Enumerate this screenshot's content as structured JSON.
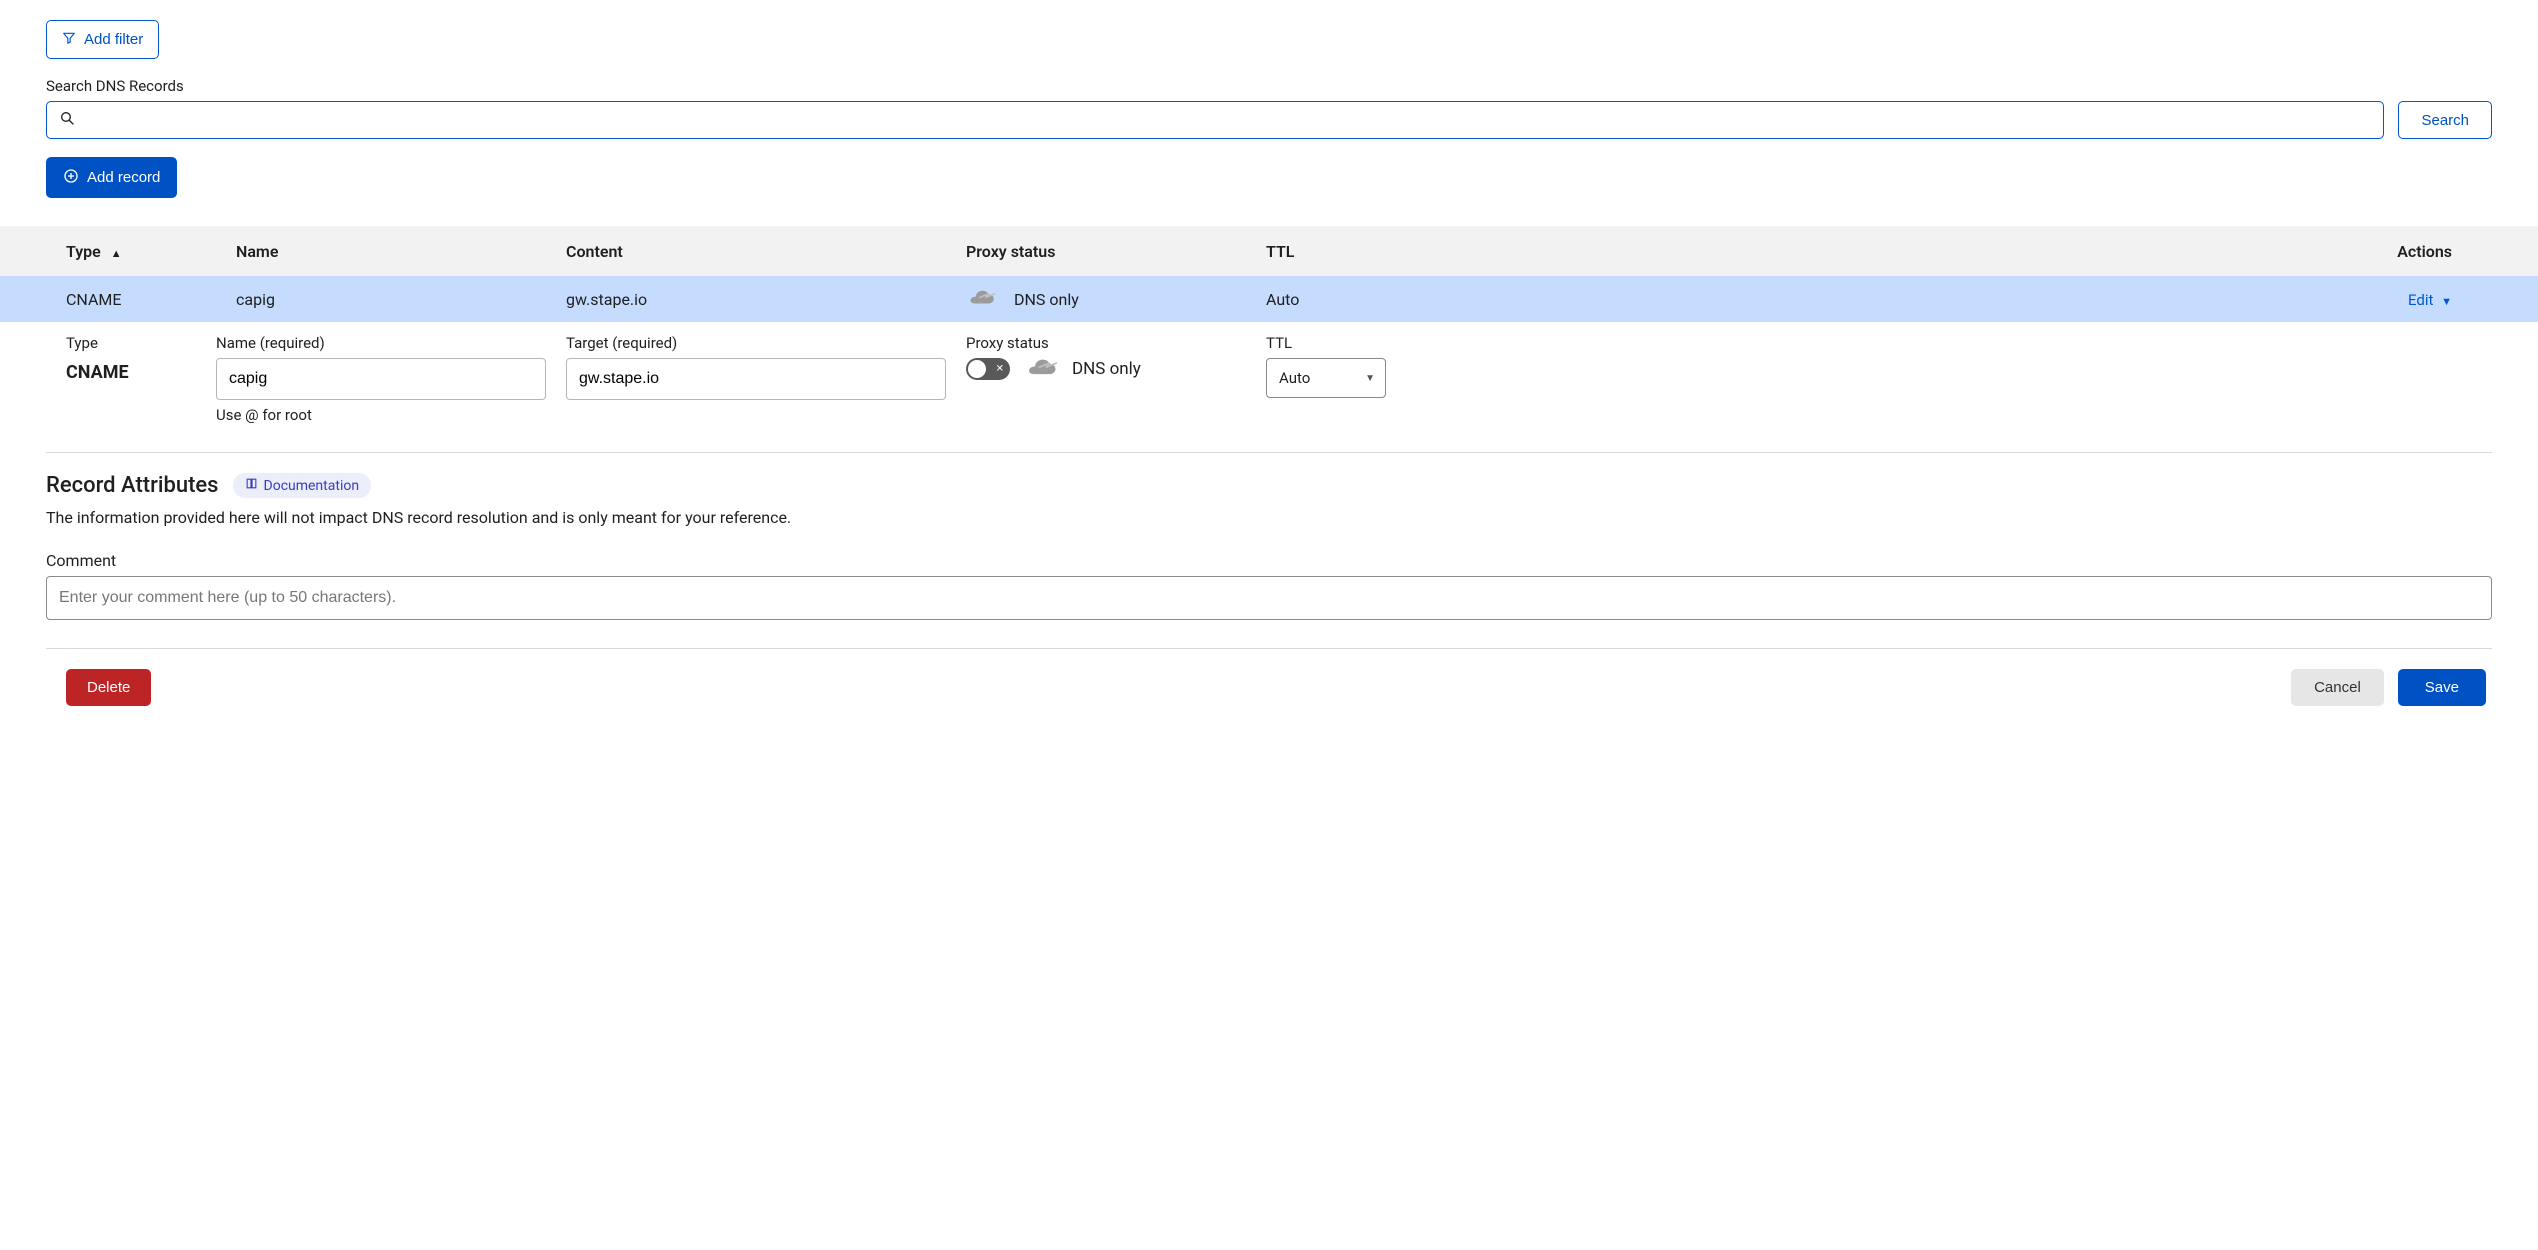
{
  "toolbar": {
    "add_filter_label": "Add filter",
    "search_label": "Search DNS Records",
    "search_button_label": "Search",
    "add_record_label": "Add record"
  },
  "table": {
    "header": {
      "type": "Type",
      "name": "Name",
      "content": "Content",
      "proxy": "Proxy status",
      "ttl": "TTL",
      "actions": "Actions"
    },
    "rows": [
      {
        "type": "CNAME",
        "name": "capig",
        "content": "gw.stape.io",
        "proxy": "DNS only",
        "ttl": "Auto",
        "action": "Edit"
      }
    ]
  },
  "editor": {
    "labels": {
      "type": "Type",
      "name": "Name (required)",
      "target": "Target (required)",
      "proxy": "Proxy status",
      "ttl": "TTL"
    },
    "values": {
      "type": "CNAME",
      "name": "capig",
      "target": "gw.stape.io",
      "proxy": "DNS only",
      "ttl": "Auto"
    },
    "help_name": "Use @ for root"
  },
  "attributes": {
    "title": "Record Attributes",
    "doc_label": "Documentation",
    "description": "The information provided here will not impact DNS record resolution and is only meant for your reference.",
    "comment_label": "Comment",
    "comment_placeholder": "Enter your comment here (up to 50 characters)."
  },
  "footer": {
    "delete": "Delete",
    "cancel": "Cancel",
    "save": "Save"
  }
}
